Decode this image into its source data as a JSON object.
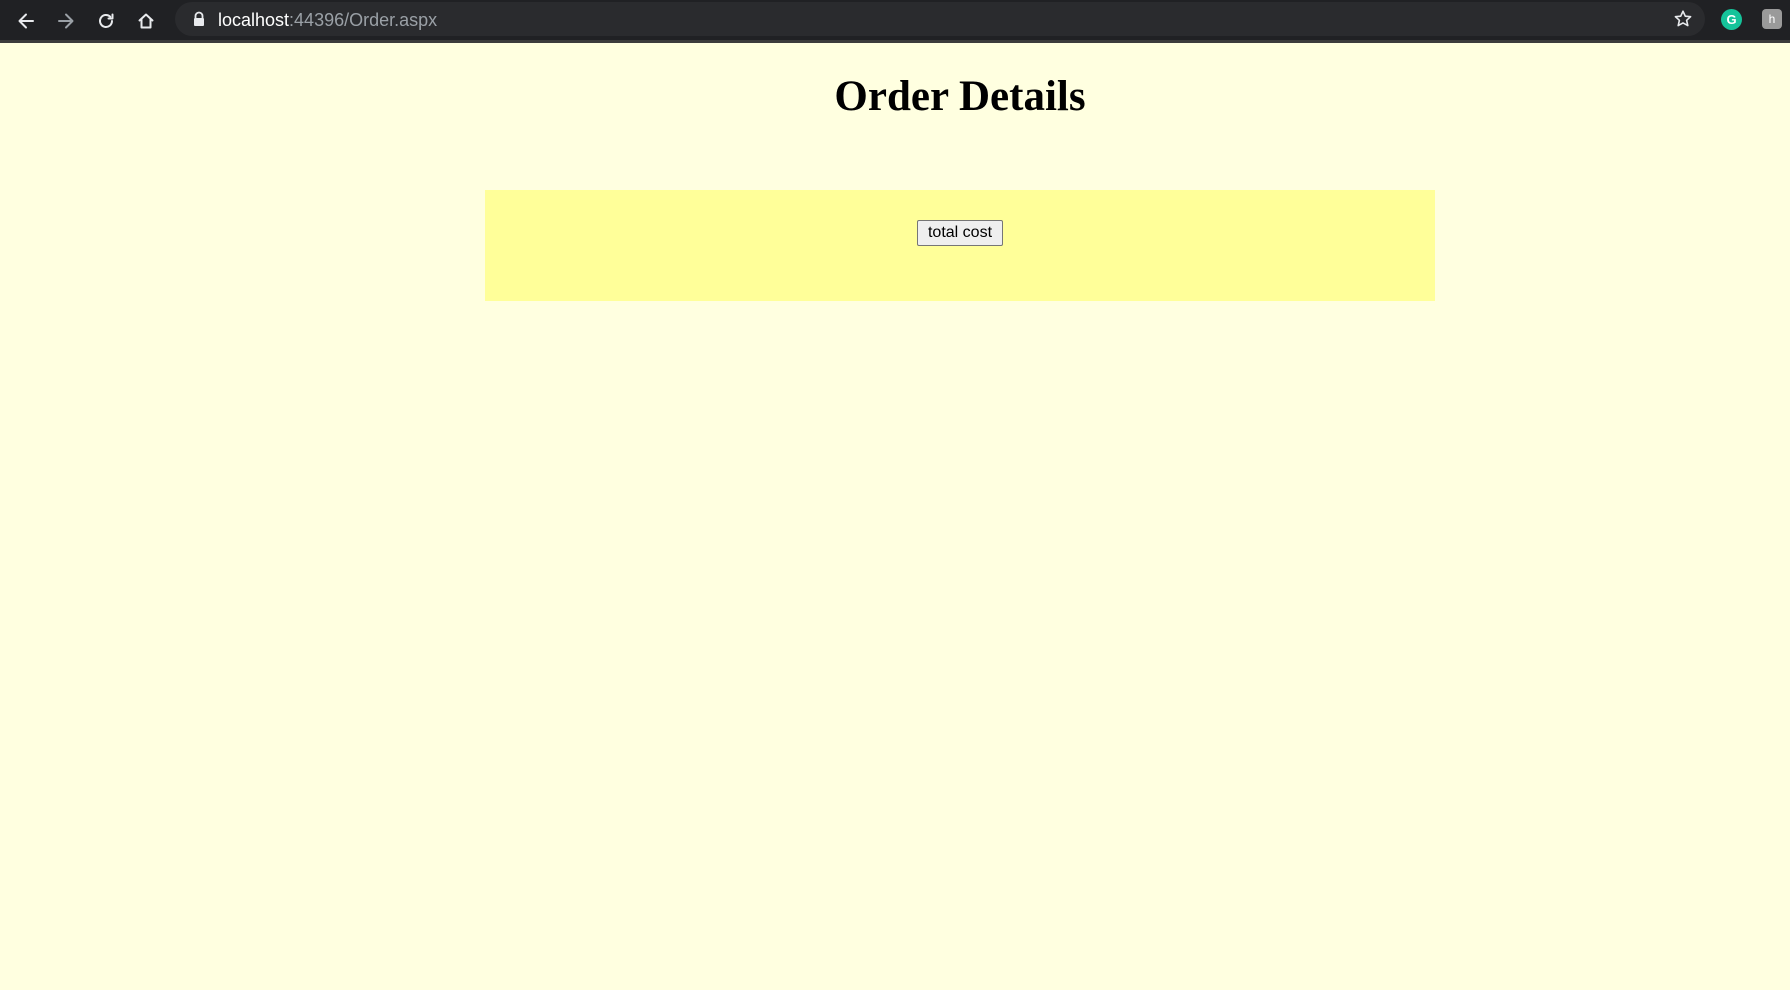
{
  "browser": {
    "url_host": "localhost",
    "url_rest": ":44396/Order.aspx",
    "icons": {
      "back": "back-arrow-icon",
      "forward": "forward-arrow-icon",
      "reload": "reload-icon",
      "home": "home-icon",
      "lock": "lock-icon",
      "bookmark": "star-icon",
      "extension_1": "grammarly-icon",
      "extension_2": "extension-icon"
    },
    "extension_1_glyph": "G",
    "extension_2_glyph": "h"
  },
  "page": {
    "title": "Order Details",
    "total_button_label": "total cost",
    "colors": {
      "background": "#ffffe0",
      "panel": "#ffff99"
    }
  }
}
